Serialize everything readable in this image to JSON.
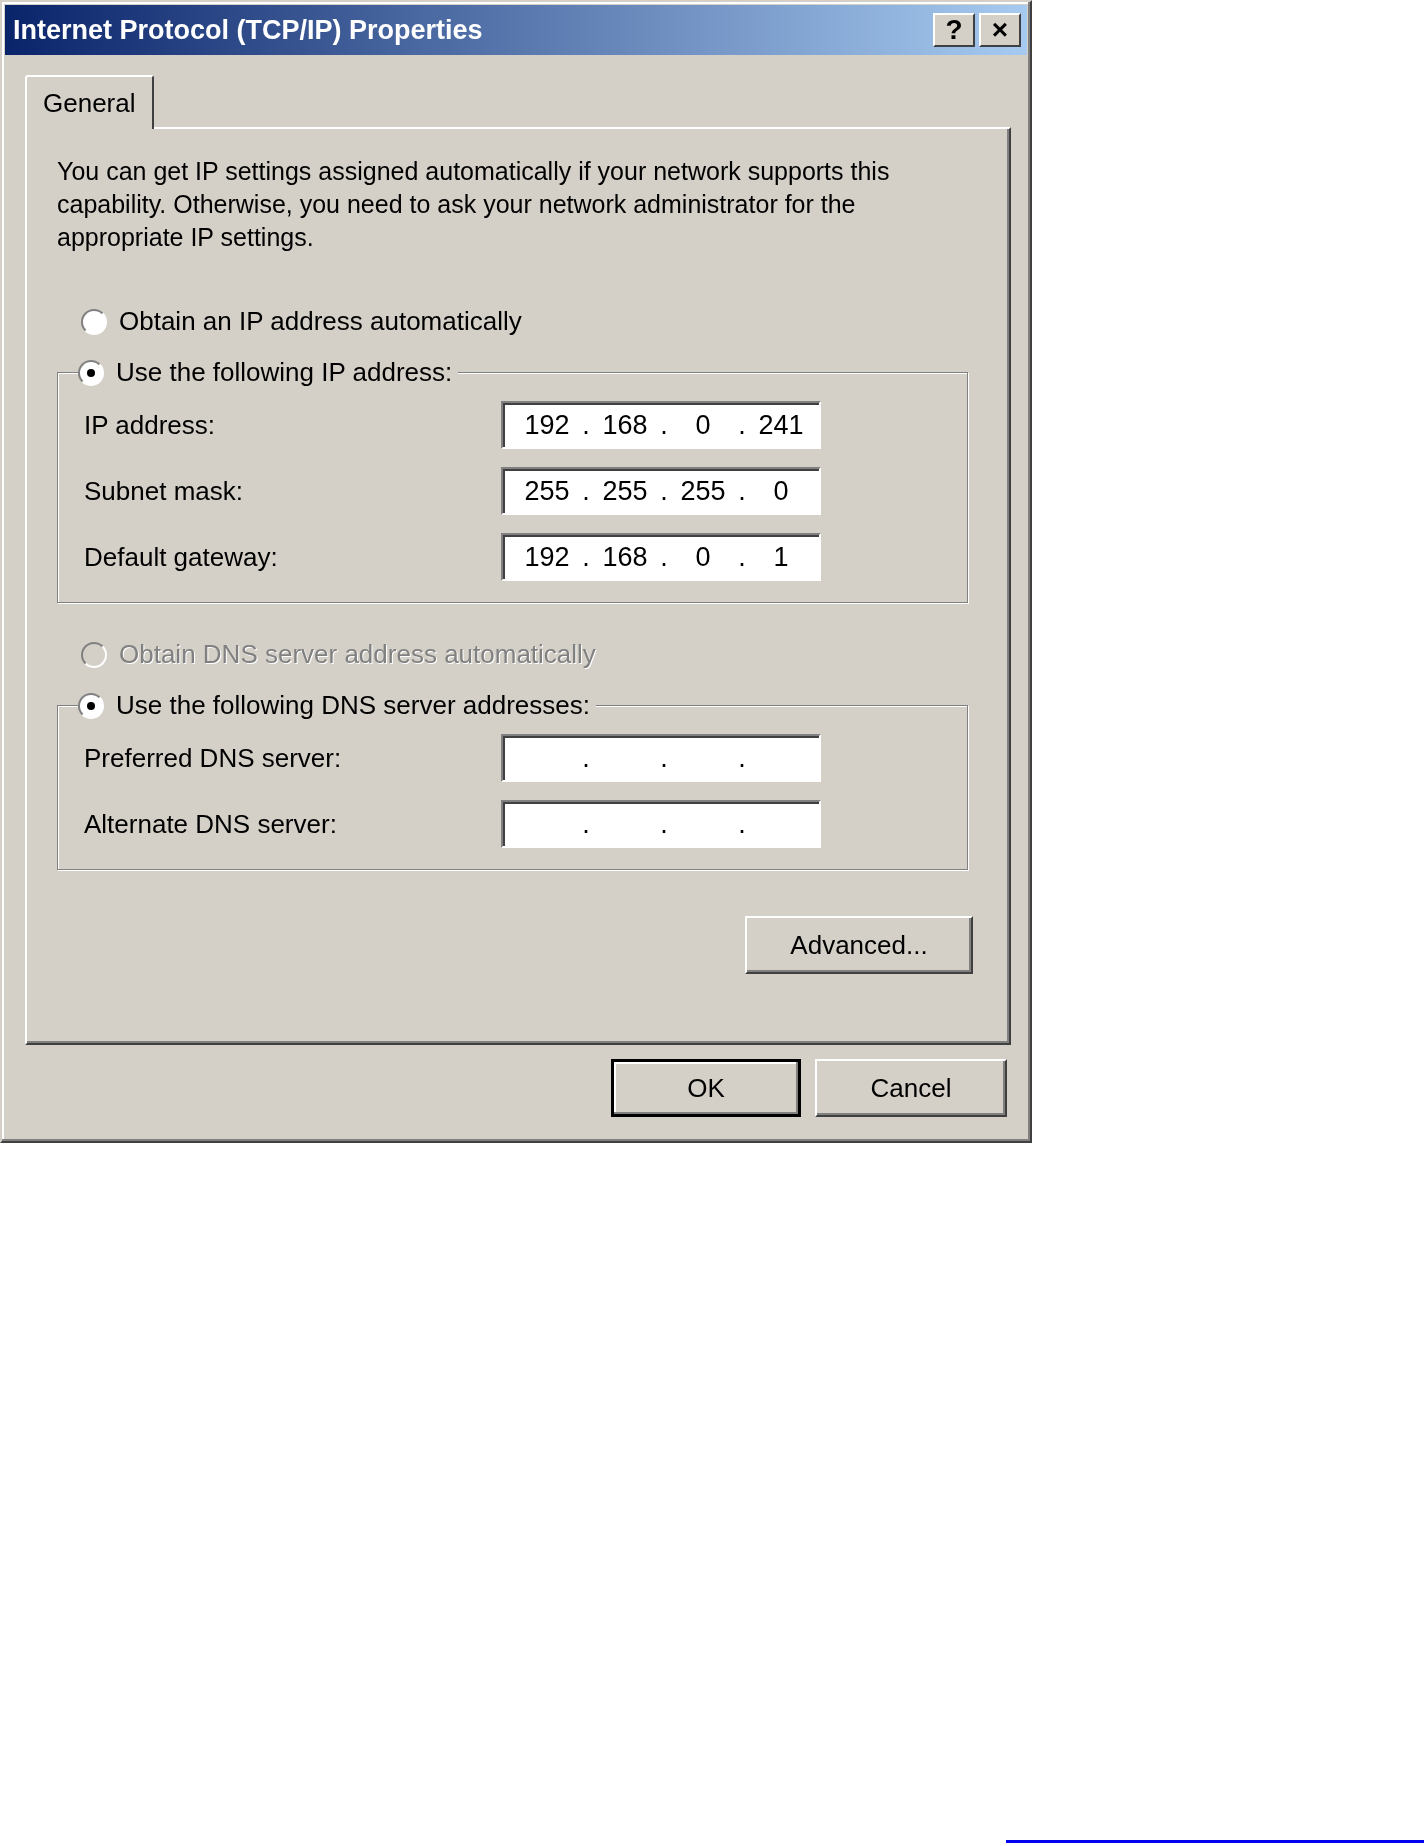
{
  "window": {
    "title": "Internet Protocol (TCP/IP) Properties",
    "title_buttons": [
      "?",
      "×"
    ]
  },
  "tabs": [
    {
      "label": "General",
      "selected": true
    }
  ],
  "intro": "You can get IP settings assigned automatically if your network supports this capability. Otherwise, you need to ask your network administrator for the appropriate IP settings.",
  "octet_separator": ".",
  "sections": [
    {
      "auto_option": {
        "label": "Obtain an IP address automatically",
        "selected": false,
        "disabled": false
      },
      "manual_option": {
        "label": "Use the following IP address:",
        "selected": true,
        "disabled": false
      },
      "fields": [
        {
          "label": "IP address:",
          "octets": [
            "192",
            "168",
            "0",
            "241"
          ]
        },
        {
          "label": "Subnet mask:",
          "octets": [
            "255",
            "255",
            "255",
            "0"
          ]
        },
        {
          "label": "Default gateway:",
          "octets": [
            "192",
            "168",
            "0",
            "1"
          ]
        }
      ]
    },
    {
      "auto_option": {
        "label": "Obtain DNS server address automatically",
        "selected": false,
        "disabled": true
      },
      "manual_option": {
        "label": "Use the following DNS server addresses:",
        "selected": true,
        "disabled": false
      },
      "fields": [
        {
          "label": "Preferred DNS server:"
        },
        {
          "label": "Alternate DNS server:"
        }
      ]
    }
  ],
  "advanced_button": "Advanced...",
  "buttons": [
    {
      "label": "OK",
      "default": true
    },
    {
      "label": "Cancel",
      "default": false
    }
  ]
}
